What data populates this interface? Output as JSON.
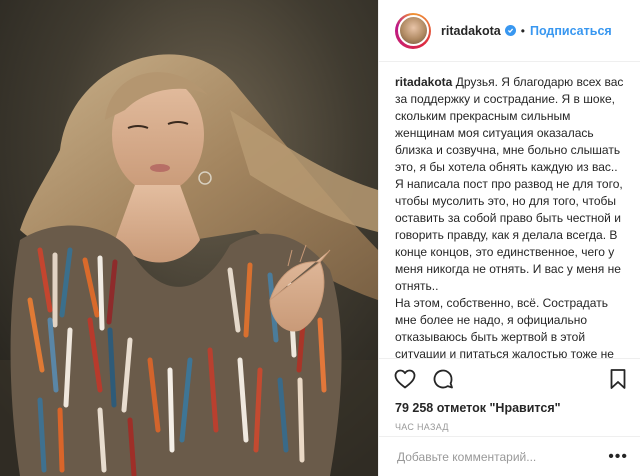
{
  "header": {
    "username": "ritadakota",
    "separator": "•",
    "follow_label": "Подписаться"
  },
  "caption": {
    "username": "ritadakota",
    "paragraph1": "Друзья. Я благодарю всех вас за поддержку и сострадание. Я в шоке, скольким прекрасным сильным женщинам моя ситуация оказалась близка и созвучна, мне больно слышать это, я бы хотела обнять каждую из вас.. Я написала пост про развод не для того, чтобы мусолить это, но для того, чтобы оставить за собой право быть честной и говорить правду, как я делала всегда. В конце концов, это единственное, чего у меня никогда не отнять. И вас у меня не отнять..",
    "paragraph2": "На этом, собственно, всё. Сострадать мне более не надо, я официально отказываюсь быть жертвой в этой ситуации и питаться жалостью тоже не намерена. Желание прессы обсасывать подробности нашего развода были мне очевидны, но и этого я не позволю, не"
  },
  "likes_text": "79 258 отметок \"Нравится\"",
  "timestamp": "час назад",
  "comment": {
    "placeholder": "Добавьте комментарий...",
    "more_label": "•••"
  },
  "colors": {
    "accent": "#3897f0",
    "text": "#262626",
    "muted": "#999999",
    "divider": "#efefef"
  },
  "icons": [
    "heart-icon",
    "comment-icon",
    "bookmark-icon",
    "verified-badge-icon"
  ]
}
